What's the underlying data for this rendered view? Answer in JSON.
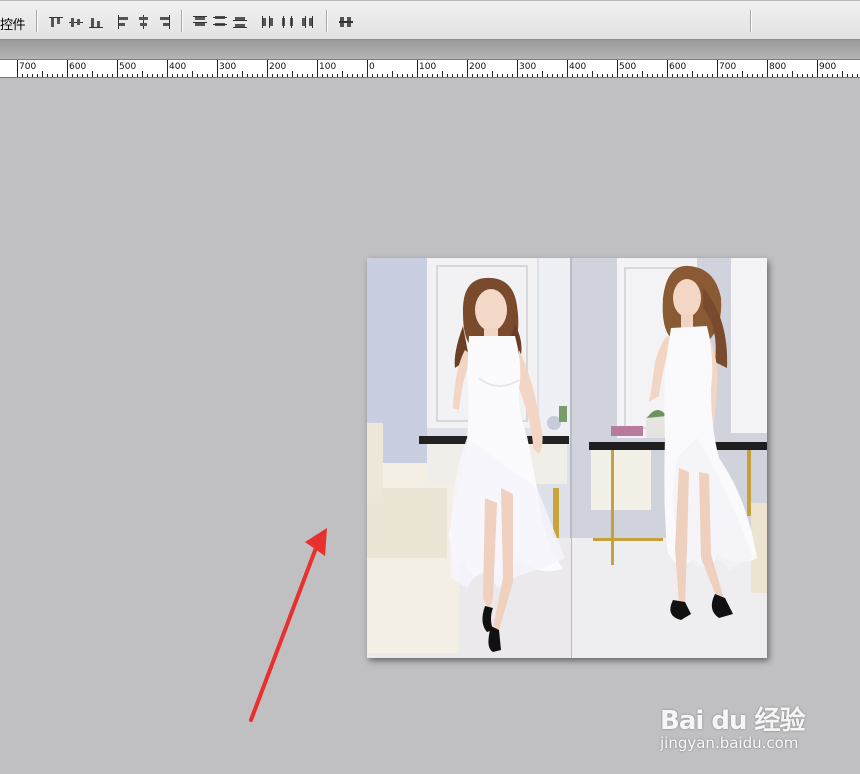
{
  "toolbar": {
    "label": "控件",
    "align_buttons": [
      "align-top-edges",
      "align-vertical-centers",
      "align-bottom-edges",
      "align-left-edges",
      "align-horizontal-centers",
      "align-right-edges"
    ],
    "distribute_buttons": [
      "distribute-top-edges",
      "distribute-vertical-centers",
      "distribute-bottom-edges",
      "distribute-left-edges",
      "distribute-horizontal-centers",
      "distribute-right-edges"
    ],
    "extra_button": "auto-align-layers"
  },
  "ruler": {
    "labels": [
      "700",
      "600",
      "500",
      "400",
      "300",
      "200",
      "100",
      "0",
      "100",
      "200",
      "300",
      "400",
      "500",
      "600",
      "700",
      "800",
      "900"
    ]
  },
  "canvas": {
    "background": "#c0bfc1",
    "arrow_color": "#e8302e"
  },
  "watermark": {
    "brand": "Bai du 经验",
    "url": "jingyan.baidu.com"
  }
}
